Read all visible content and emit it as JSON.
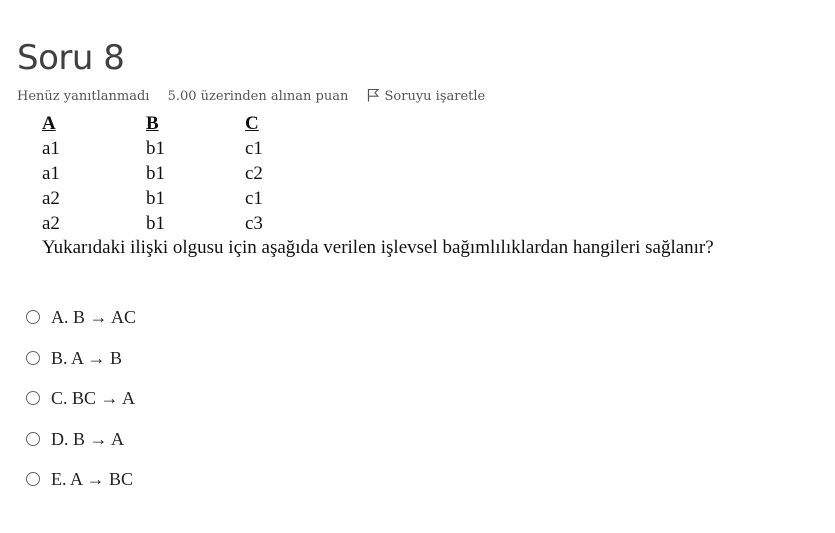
{
  "question": {
    "title": "Soru 8",
    "status": "Henüz yanıtlanmadı",
    "grade": "5.00 üzerinden alınan puan",
    "flag_label": "Soruyu işaretle",
    "text": "Yukarıdaki ilişki olgusu için aşağıda verilen işlevsel bağımlılıklardan hangileri sağlanır?"
  },
  "relation": {
    "headers": [
      "A",
      "B",
      "C"
    ],
    "rows": [
      [
        "a1",
        "b1",
        "c1"
      ],
      [
        "a1",
        "b1",
        "c2"
      ],
      [
        "a2",
        "b1",
        "c1"
      ],
      [
        "a2",
        "b1",
        "c3"
      ]
    ]
  },
  "options": [
    {
      "label": "A. B → AC"
    },
    {
      "label": "B. A → B"
    },
    {
      "label": "C. BC → A"
    },
    {
      "label": "D. B → A"
    },
    {
      "label": "E. A → BC"
    }
  ],
  "icons": {
    "flag": "flag-icon",
    "radio": "radio-button-icon"
  }
}
